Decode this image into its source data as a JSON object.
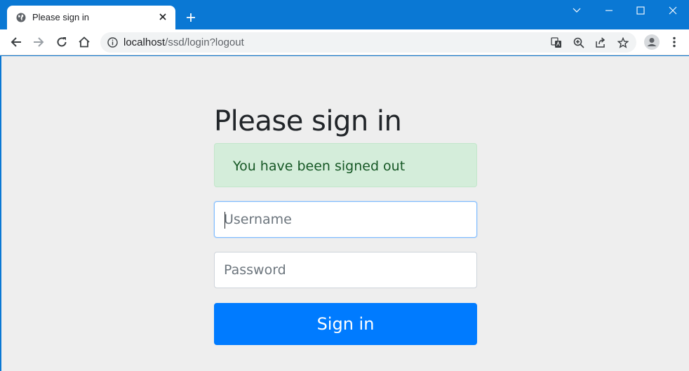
{
  "browser": {
    "tab": {
      "title": "Please sign in",
      "icon": "globe-icon"
    },
    "new_tab_icon": "plus-icon",
    "window_controls": [
      "chevron-down-icon",
      "minimize-icon",
      "maximize-icon",
      "close-icon"
    ],
    "nav": [
      "back-icon",
      "forward-icon",
      "reload-icon",
      "home-icon"
    ],
    "address": {
      "host": "localhost",
      "path": "/ssd/login?logout"
    },
    "omnibox_icons": [
      "translate-icon",
      "zoom-icon",
      "share-icon",
      "bookmark-star-icon"
    ],
    "accent_color": "#0a78d4"
  },
  "page": {
    "heading": "Please sign in",
    "alert": {
      "text": "You have been signed out",
      "color": "#155724",
      "background": "#d4edda"
    },
    "username": {
      "placeholder": "Username",
      "value": ""
    },
    "password": {
      "placeholder": "Password",
      "value": ""
    },
    "submit_label": "Sign in",
    "button_color": "#007bff"
  }
}
